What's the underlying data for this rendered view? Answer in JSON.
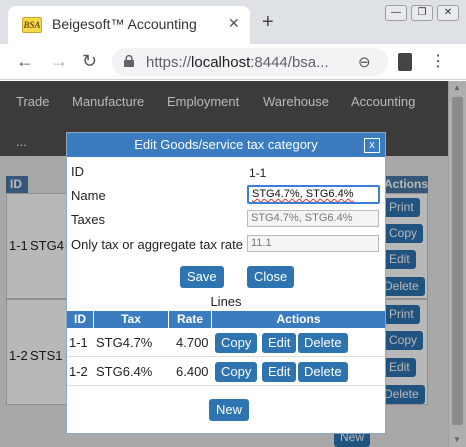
{
  "browser": {
    "tab_title": "Beigesoft™ Accounting",
    "favicon_text": "BSA",
    "tab_close": "✕",
    "new_tab": "+",
    "url_scheme": "https://",
    "url_host": "localhost",
    "url_rest": ":8444/bsa...",
    "window_controls": [
      "—",
      "❐",
      "✕"
    ],
    "back": "←",
    "forward": "→",
    "reload": "↻",
    "zoom_symbol": "⊖",
    "menu": "⋮"
  },
  "app_nav": {
    "items": [
      "Trade",
      "Manufacture",
      "Employment",
      "Warehouse",
      "Accounting"
    ],
    "more": "..."
  },
  "background_table": {
    "headers": [
      "ID",
      "Actions"
    ],
    "rows": [
      {
        "id": "1-1",
        "name": "STG4",
        "buttons": [
          "Print",
          "Copy",
          "Edit",
          "Delete"
        ]
      },
      {
        "id": "1-2",
        "name": "STS1",
        "buttons": [
          "Print",
          "Copy",
          "Edit",
          "Delete"
        ]
      }
    ],
    "new_label": "New"
  },
  "dialog": {
    "title": "Edit Goods/service tax category",
    "close_label": "x",
    "fields": {
      "id_label": "ID",
      "id_value": "1-1",
      "name_label": "Name",
      "name_value": "STG4.7%, STG6.4%",
      "taxes_label": "Taxes",
      "taxes_value": "STG4.7%, STG6.4%",
      "rate_label": "Only tax or aggregate tax rate",
      "rate_value": "11.1"
    },
    "save_label": "Save",
    "close_button_label": "Close",
    "lines_title": "Lines",
    "lines_headers": [
      "ID",
      "Tax",
      "Rate",
      "Actions"
    ],
    "lines": [
      {
        "id": "1-1",
        "tax": "STG4.7%",
        "rate": "4.700"
      },
      {
        "id": "1-2",
        "tax": "STG6.4%",
        "rate": "6.400"
      }
    ],
    "line_buttons": [
      "Copy",
      "Edit",
      "Delete"
    ],
    "new_label": "New"
  },
  "colors": {
    "accent": "#3b7bbf",
    "button": "#2d74b0",
    "nav_bg": "#555250"
  }
}
